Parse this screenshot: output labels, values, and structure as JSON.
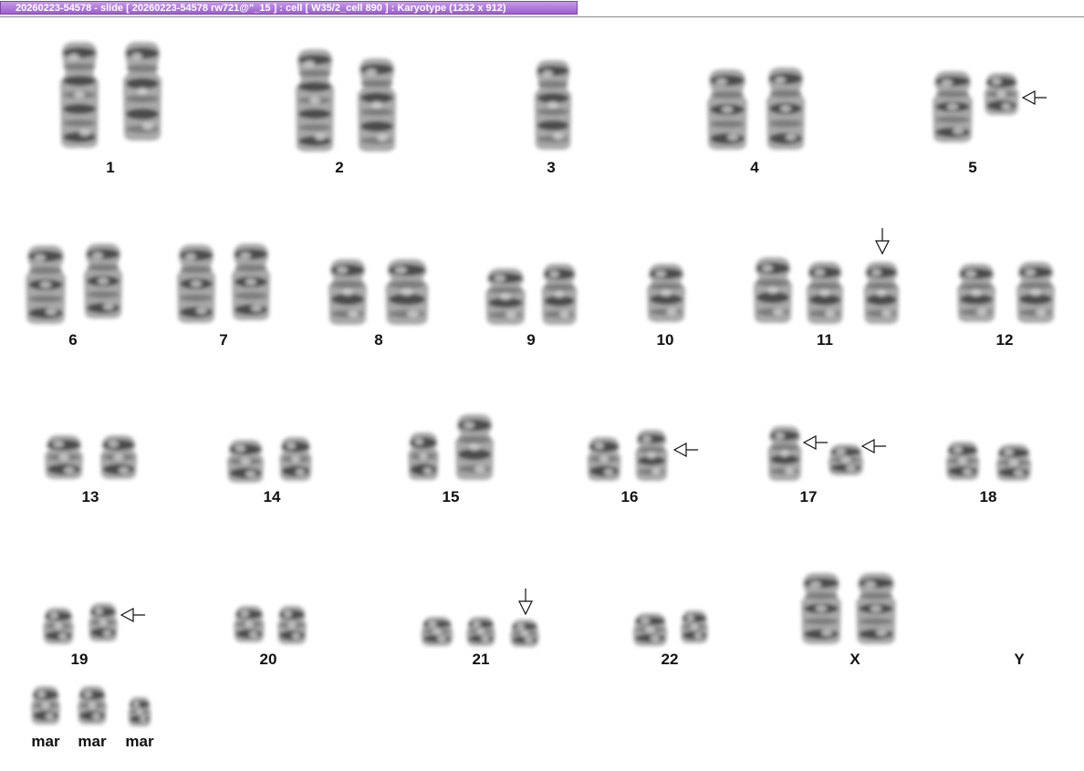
{
  "window": {
    "title": "20260223-54578 - slide [ 20260223-54578 rw721@\"_15 ] : cell [ W35/2_cell 890 ] : Karyotype  (1232 x 912)"
  },
  "karyotype": {
    "chromosomes": [
      {
        "label": "1",
        "count": 2
      },
      {
        "label": "2",
        "count": 2
      },
      {
        "label": "3",
        "count": 1
      },
      {
        "label": "4",
        "count": 2
      },
      {
        "label": "5",
        "count": 2,
        "abnormal_marked": [
          2
        ]
      },
      {
        "label": "6",
        "count": 2
      },
      {
        "label": "7",
        "count": 2
      },
      {
        "label": "8",
        "count": 2
      },
      {
        "label": "9",
        "count": 2
      },
      {
        "label": "10",
        "count": 1
      },
      {
        "label": "11",
        "count": 3,
        "abnormal_marked": [
          3
        ]
      },
      {
        "label": "12",
        "count": 2
      },
      {
        "label": "13",
        "count": 2
      },
      {
        "label": "14",
        "count": 2
      },
      {
        "label": "15",
        "count": 2
      },
      {
        "label": "16",
        "count": 2,
        "abnormal_marked": [
          2
        ]
      },
      {
        "label": "17",
        "count": 2,
        "abnormal_marked": [
          1,
          2
        ]
      },
      {
        "label": "18",
        "count": 2
      },
      {
        "label": "19",
        "count": 2,
        "abnormal_marked": [
          2
        ]
      },
      {
        "label": "20",
        "count": 2
      },
      {
        "label": "21",
        "count": 3,
        "abnormal_marked": [
          3
        ]
      },
      {
        "label": "22",
        "count": 2
      },
      {
        "label": "X",
        "count": 2
      },
      {
        "label": "Y",
        "count": 0
      },
      {
        "label": "mar",
        "count": 1
      },
      {
        "label": "mar",
        "count": 1
      },
      {
        "label": "mar",
        "count": 1
      }
    ]
  }
}
